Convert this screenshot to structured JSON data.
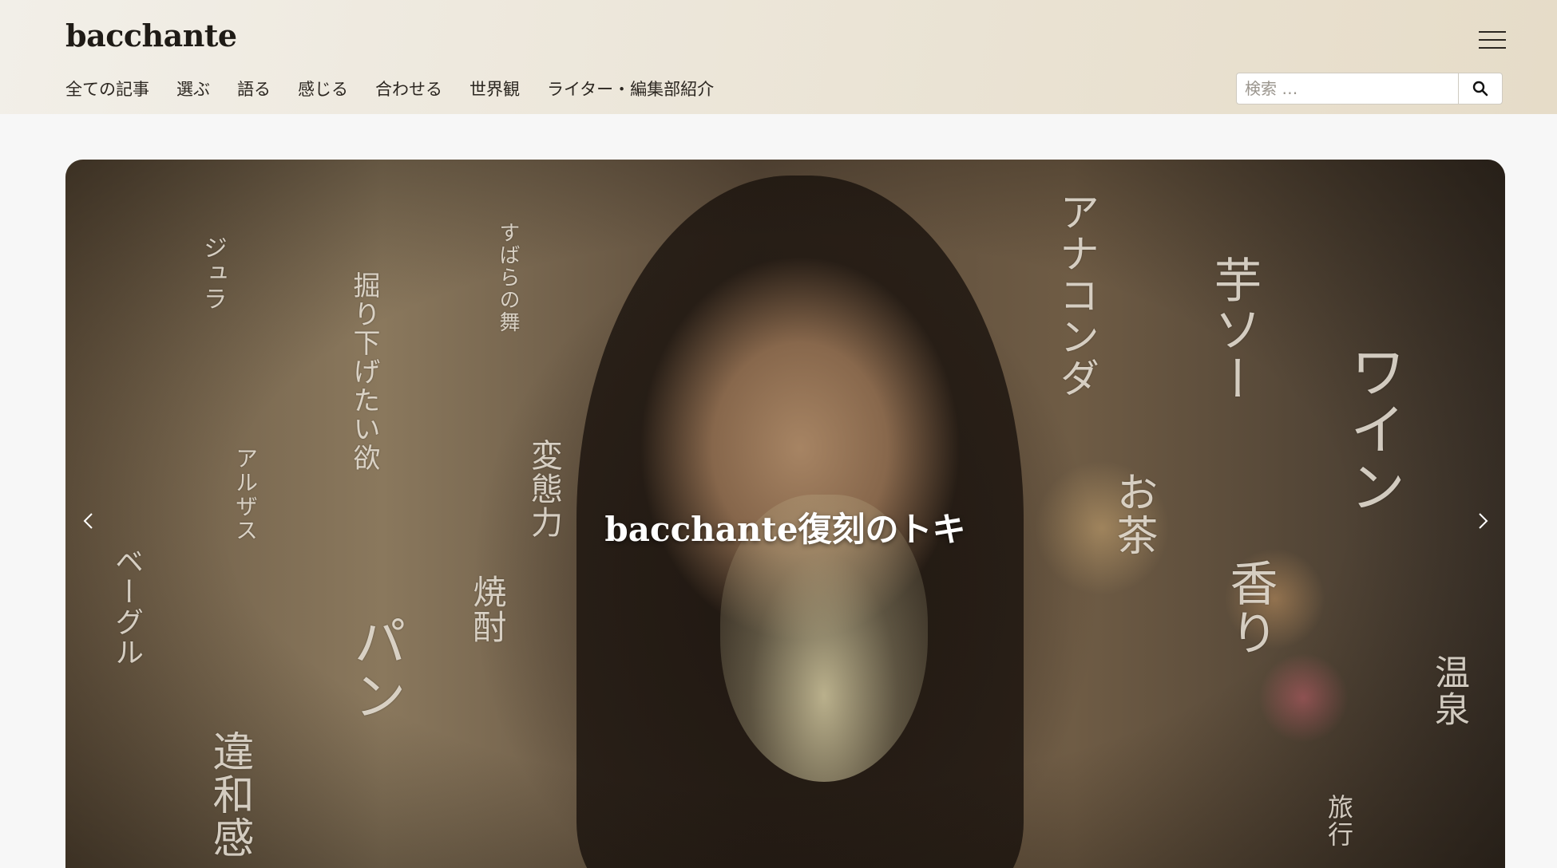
{
  "site": {
    "logo": "bacchante"
  },
  "nav": {
    "items": [
      {
        "label": "全ての記事"
      },
      {
        "label": "選ぶ"
      },
      {
        "label": "語る"
      },
      {
        "label": "感じる"
      },
      {
        "label": "合わせる"
      },
      {
        "label": "世界観"
      },
      {
        "label": "ライター・編集部紹介"
      }
    ]
  },
  "search": {
    "placeholder": "検索 …",
    "icon": "search-icon"
  },
  "menu": {
    "icon": "hamburger-menu-icon"
  },
  "hero": {
    "title": "bacchante復刻のトキ",
    "prev_icon": "chevron-left-icon",
    "next_icon": "chevron-right-icon",
    "words": [
      {
        "text": "ジュラ"
      },
      {
        "text": "掘り下げたい欲"
      },
      {
        "text": "すばらの舞"
      },
      {
        "text": "アルザス"
      },
      {
        "text": "変態力"
      },
      {
        "text": "ベーグル"
      },
      {
        "text": "焼酎"
      },
      {
        "text": "パン"
      },
      {
        "text": "違和感"
      },
      {
        "text": "アナコンダ"
      },
      {
        "text": "芋ソー"
      },
      {
        "text": "ワイン"
      },
      {
        "text": "お茶"
      },
      {
        "text": "香り"
      },
      {
        "text": "温泉"
      },
      {
        "text": "旅行"
      }
    ]
  }
}
